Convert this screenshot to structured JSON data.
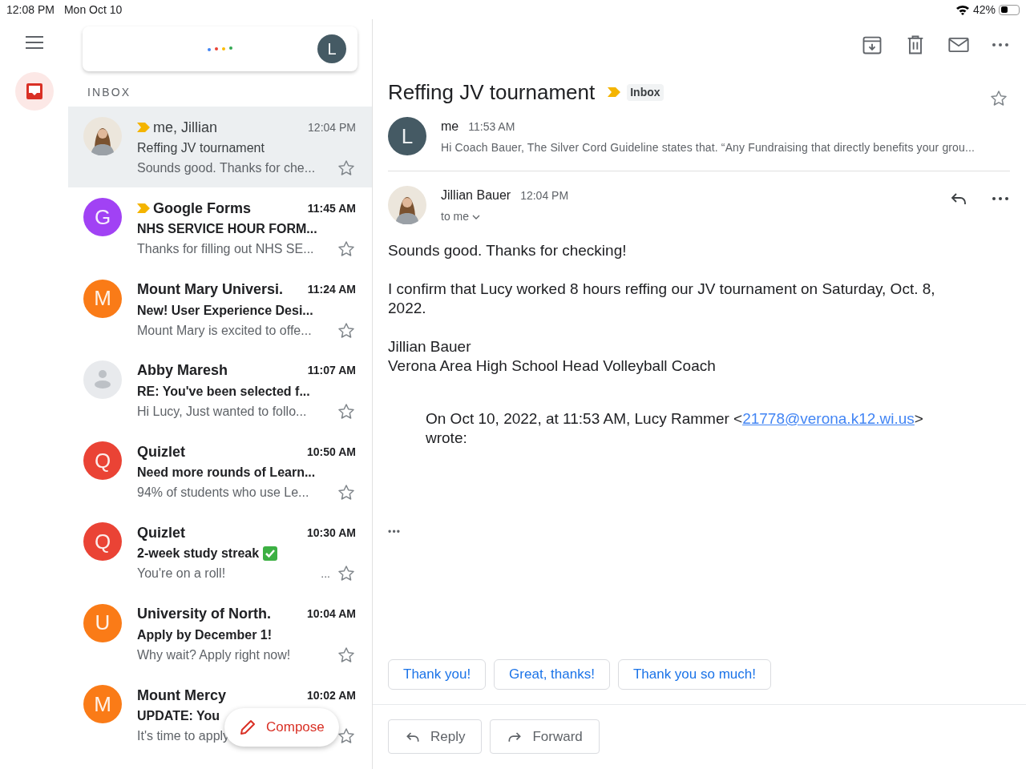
{
  "status_bar": {
    "time": "12:08 PM",
    "date": "Mon Oct 10",
    "battery": "42%"
  },
  "search": {
    "account_letter": "L"
  },
  "sidebar": {
    "items": [
      {
        "kind": "inbox",
        "selected": true
      }
    ]
  },
  "list_title": "INBOX",
  "emails": [
    {
      "sender": "me, Jillian",
      "time": "12:04 PM",
      "subject": "Reffing JV tournament",
      "snippet": "Sounds good. Thanks for che...",
      "unread": false,
      "important": true,
      "selected": true,
      "starred": false,
      "avatar": {
        "kind": "photo"
      }
    },
    {
      "sender": "Google Forms",
      "time": "11:45 AM",
      "subject": "NHS SERVICE HOUR FORM...",
      "snippet": "Thanks for filling out NHS SE...",
      "unread": true,
      "important": true,
      "selected": false,
      "starred": false,
      "avatar": {
        "kind": "letter",
        "letter": "G",
        "color": "#a142f4"
      }
    },
    {
      "sender": "Mount Mary Universi.",
      "time": "11:24 AM",
      "subject": "New! User Experience Desi...",
      "snippet": "Mount Mary is excited to offe...",
      "unread": true,
      "important": false,
      "selected": false,
      "starred": false,
      "avatar": {
        "kind": "letter",
        "letter": "M",
        "color": "#fa7b17"
      }
    },
    {
      "sender": "Abby Maresh",
      "time": "11:07 AM",
      "subject": "RE: You've been selected f...",
      "snippet": "Hi Lucy, Just wanted to follo...",
      "unread": true,
      "important": false,
      "selected": false,
      "starred": false,
      "avatar": {
        "kind": "silhouette"
      }
    },
    {
      "sender": "Quizlet",
      "time": "10:50 AM",
      "subject": "Need more rounds of Learn...",
      "snippet": "94% of students who use Le...",
      "unread": true,
      "important": false,
      "selected": false,
      "starred": false,
      "avatar": {
        "kind": "letter",
        "letter": "Q",
        "color": "#ea4335"
      }
    },
    {
      "sender": "Quizlet",
      "time": "10:30 AM",
      "subject": "2-week study streak",
      "subject_check": true,
      "snippet": "You're on a roll!",
      "trail": "...",
      "unread": true,
      "important": false,
      "selected": false,
      "starred": false,
      "avatar": {
        "kind": "letter",
        "letter": "Q",
        "color": "#ea4335"
      }
    },
    {
      "sender": "University of North.",
      "time": "10:04 AM",
      "subject": "Apply by December 1!",
      "snippet": "Why wait? Apply right now!",
      "unread": true,
      "important": false,
      "selected": false,
      "starred": false,
      "avatar": {
        "kind": "letter",
        "letter": "U",
        "color": "#fa7b17"
      }
    },
    {
      "sender": "Mount Mercy",
      "time": "10:02 AM",
      "subject": "UPDATE: You",
      "snippet": "It's time to apply",
      "unread": true,
      "important": false,
      "selected": false,
      "starred": false,
      "avatar": {
        "kind": "letter",
        "letter": "M",
        "color": "#fa7b17"
      }
    }
  ],
  "compose": {
    "label": "Compose"
  },
  "thread": {
    "subject": "Reffing JV tournament",
    "important": true,
    "label": "Inbox",
    "starred": false,
    "messages": [
      {
        "kind": "collapsed",
        "sender": "me",
        "time": "11:53 AM",
        "snippet": "Hi Coach Bauer, The Silver Cord Guideline states that. “Any Fundraising that directly benefits your grou...",
        "avatar": {
          "kind": "letter",
          "letter": "L",
          "color": "#455a64"
        }
      },
      {
        "kind": "expanded",
        "sender": "Jillian Bauer",
        "time": "12:04 PM",
        "to": "to me",
        "avatar": {
          "kind": "photo"
        },
        "paragraphs": [
          [
            "Sounds good. Thanks for checking!"
          ],
          [
            "I confirm that Lucy worked 8 hours reffing our JV tournament on Saturday, Oct. 8, 2022."
          ],
          [
            "Jillian Bauer",
            "Verona Area High School Head Volleyball Coach"
          ]
        ],
        "quote": {
          "before": "On Oct 10, 2022, at 11:53 AM, Lucy Rammer <",
          "link": "21778@verona.k12.wi.us",
          "after": ">",
          "line2": "wrote:"
        },
        "more": "•••"
      }
    ],
    "smart_replies": [
      "Thank you!",
      "Great, thanks!",
      "Thank you so much!"
    ],
    "actions": [
      {
        "kind": "reply",
        "label": "Reply"
      },
      {
        "kind": "forward",
        "label": "Forward"
      }
    ]
  }
}
